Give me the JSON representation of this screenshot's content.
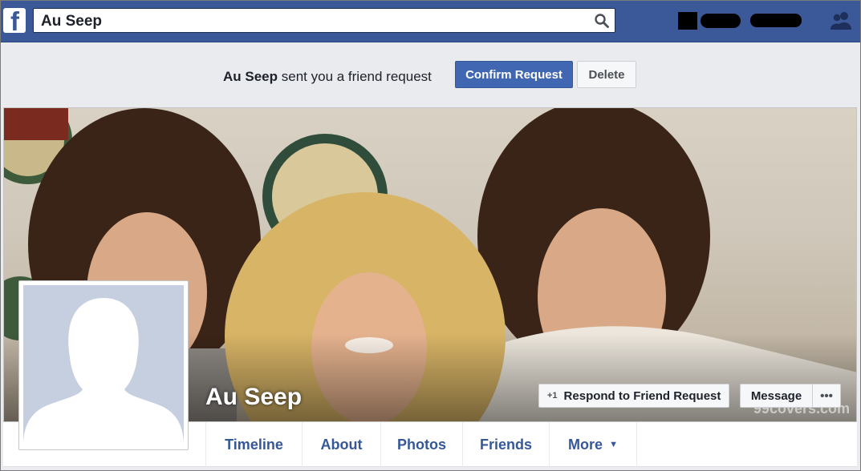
{
  "search": {
    "value": "Au Seep"
  },
  "request": {
    "name": "Au Seep",
    "message": " sent you a friend request",
    "confirm_label": "Confirm Request",
    "delete_label": "Delete"
  },
  "cover": {
    "watermark": "99covers.com"
  },
  "profile": {
    "name": "Au Seep",
    "respond_label": "Respond to Friend Request",
    "message_label": "Message",
    "more_label": "•••"
  },
  "tabs": [
    {
      "label": "Timeline"
    },
    {
      "label": "About"
    },
    {
      "label": "Photos"
    },
    {
      "label": "Friends"
    },
    {
      "label": "More"
    }
  ],
  "icons": {
    "logo": "facebook-logo-icon",
    "search": "search-icon",
    "friends": "friend-requests-icon",
    "respond": "add-friend-icon",
    "caret": "caret-down-icon"
  },
  "colors": {
    "brand": "#3b5998",
    "button_primary": "#4267b2",
    "link": "#365899"
  }
}
